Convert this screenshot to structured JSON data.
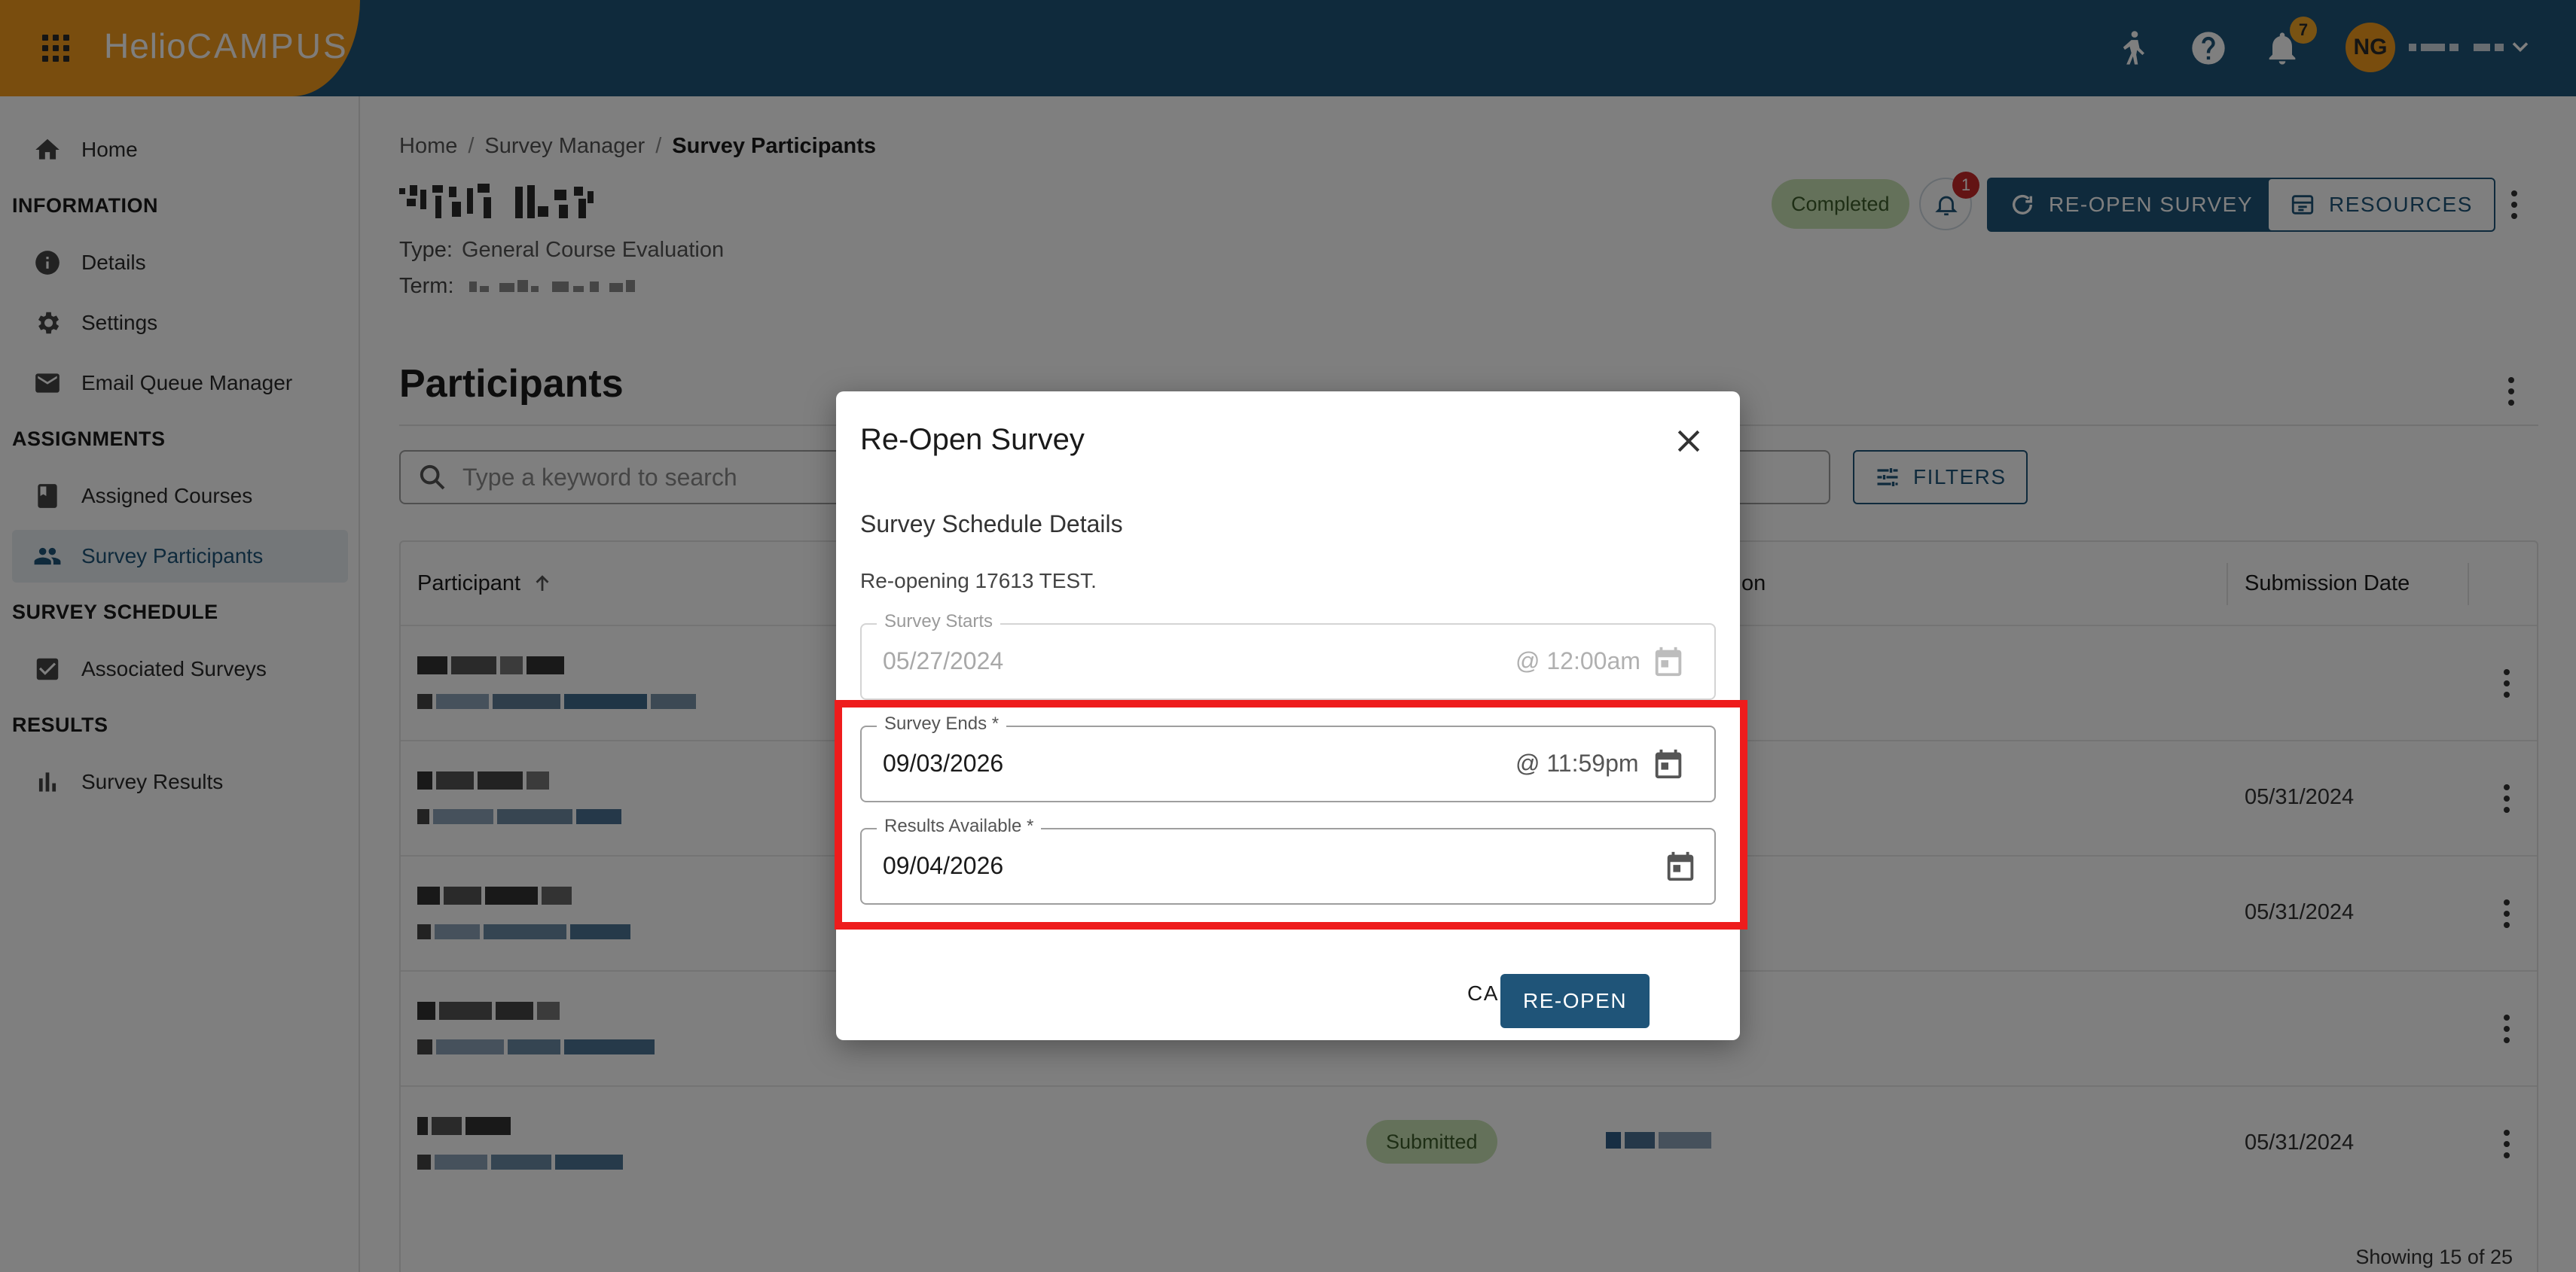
{
  "topbar": {
    "logo_part1": "Helio",
    "logo_part2": "CAMPUS",
    "notification_count": "7",
    "avatar_initials": "NG",
    "icons": [
      "apps-grid-icon",
      "accessibility-icon",
      "help-icon",
      "bell-icon",
      "chevron-down-icon"
    ]
  },
  "sidebar": {
    "home": "Home",
    "sections": {
      "information": "INFORMATION",
      "assignments": "ASSIGNMENTS",
      "survey_schedule": "SURVEY SCHEDULE",
      "results": "RESULTS"
    },
    "items": {
      "details": "Details",
      "settings": "Settings",
      "email_queue": "Email Queue Manager",
      "assigned_courses": "Assigned Courses",
      "survey_participants": "Survey Participants",
      "associated_surveys": "Associated Surveys",
      "survey_results": "Survey Results"
    },
    "active": "survey_participants"
  },
  "breadcrumb": {
    "home": "Home",
    "survey_manager": "Survey Manager",
    "current": "Survey Participants",
    "separator": "/"
  },
  "survey": {
    "type_label": "Type:",
    "type_value": "General Course Evaluation",
    "term_label": "Term:",
    "status": "Completed",
    "alert_count": "1"
  },
  "actions": {
    "reopen_survey": "RE-OPEN SURVEY",
    "resources": "RESOURCES"
  },
  "participants": {
    "heading": "Participants",
    "search_placeholder": "Type a keyword to search",
    "filters": "FILTERS",
    "columns": {
      "participant": "Participant",
      "submission_fragment": "on",
      "submission_date": "Submission Date"
    },
    "rows": [
      {
        "submission_date": "",
        "status": ""
      },
      {
        "submission_date": "05/31/2024",
        "status": ""
      },
      {
        "submission_date": "05/31/2024",
        "status": ""
      },
      {
        "submission_date": "",
        "status": ""
      },
      {
        "submission_date": "05/31/2024",
        "status": "Submitted"
      }
    ],
    "showing": "Showing 15 of 25"
  },
  "dialog": {
    "title": "Re-Open Survey",
    "subtitle": "Survey Schedule Details",
    "note": "Re-opening 17613 TEST.",
    "survey_starts": {
      "label": "Survey Starts",
      "value": "05/27/2024",
      "time": "@ 12:00am"
    },
    "survey_ends": {
      "label": "Survey Ends *",
      "value": "09/03/2026",
      "time": "@ 11:59pm"
    },
    "results_available": {
      "label": "Results Available *",
      "value": "09/04/2026"
    },
    "cancel": "CANCEL",
    "reopen": "RE-OPEN"
  },
  "colors": {
    "brand_navy": "#1f5478",
    "brand_orange": "#f29b1d",
    "status_green": "#c9e3b4",
    "highlight_red": "#ee1c1c"
  }
}
